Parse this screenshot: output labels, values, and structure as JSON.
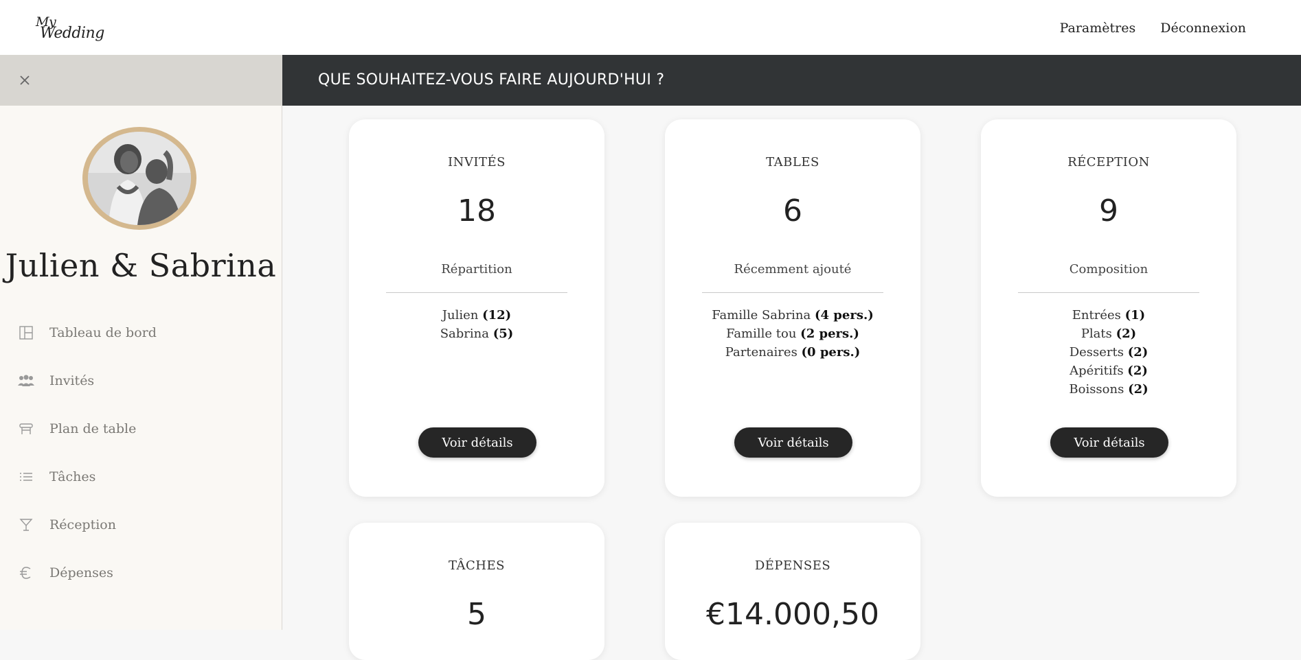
{
  "header": {
    "logo_line1": "My",
    "logo_line2": "Wedding",
    "nav": {
      "settings": "Paramètres",
      "logout": "Déconnexion"
    }
  },
  "sidebar": {
    "couple": "Julien & Sabrina",
    "items": [
      {
        "label": "Tableau de bord",
        "icon": "dashboard-icon"
      },
      {
        "label": "Invités",
        "icon": "guests-icon"
      },
      {
        "label": "Plan de table",
        "icon": "table-plan-icon"
      },
      {
        "label": "Tâches",
        "icon": "tasks-icon"
      },
      {
        "label": "Réception",
        "icon": "cocktail-icon"
      },
      {
        "label": "Dépenses",
        "icon": "euro-icon"
      }
    ]
  },
  "main": {
    "title": "QUE SOUHAITEZ-VOUS FAIRE AUJOURD'HUI ?",
    "cards": [
      {
        "title": "INVITÉS",
        "value": "18",
        "subtitle": "Répartition",
        "lines": [
          {
            "text": "Julien ",
            "bold": "(12)"
          },
          {
            "text": "Sabrina ",
            "bold": "(5)"
          }
        ],
        "button": "Voir détails"
      },
      {
        "title": "TABLES",
        "value": "6",
        "subtitle": "Récemment ajouté",
        "lines": [
          {
            "text": "Famille Sabrina ",
            "bold": "(4 pers.)"
          },
          {
            "text": "Famille tou ",
            "bold": "(2 pers.)"
          },
          {
            "text": "Partenaires ",
            "bold": "(0 pers.)"
          }
        ],
        "button": "Voir détails"
      },
      {
        "title": "RÉCEPTION",
        "value": "9",
        "subtitle": "Composition",
        "lines": [
          {
            "text": "Entrées ",
            "bold": "(1)"
          },
          {
            "text": "Plats ",
            "bold": "(2)"
          },
          {
            "text": "Desserts ",
            "bold": "(2)"
          },
          {
            "text": "Apéritifs ",
            "bold": "(2)"
          },
          {
            "text": "Boissons ",
            "bold": "(2)"
          }
        ],
        "button": "Voir détails"
      },
      {
        "title": "TÂCHES",
        "value": "5"
      },
      {
        "title": "DÉPENSES",
        "value": "€14.000,50"
      }
    ]
  },
  "colors": {
    "header_bg": "#313436",
    "button_bg": "#262626",
    "avatar_ring": "#d4b88e",
    "sidebar_bg": "#faf8f4"
  }
}
